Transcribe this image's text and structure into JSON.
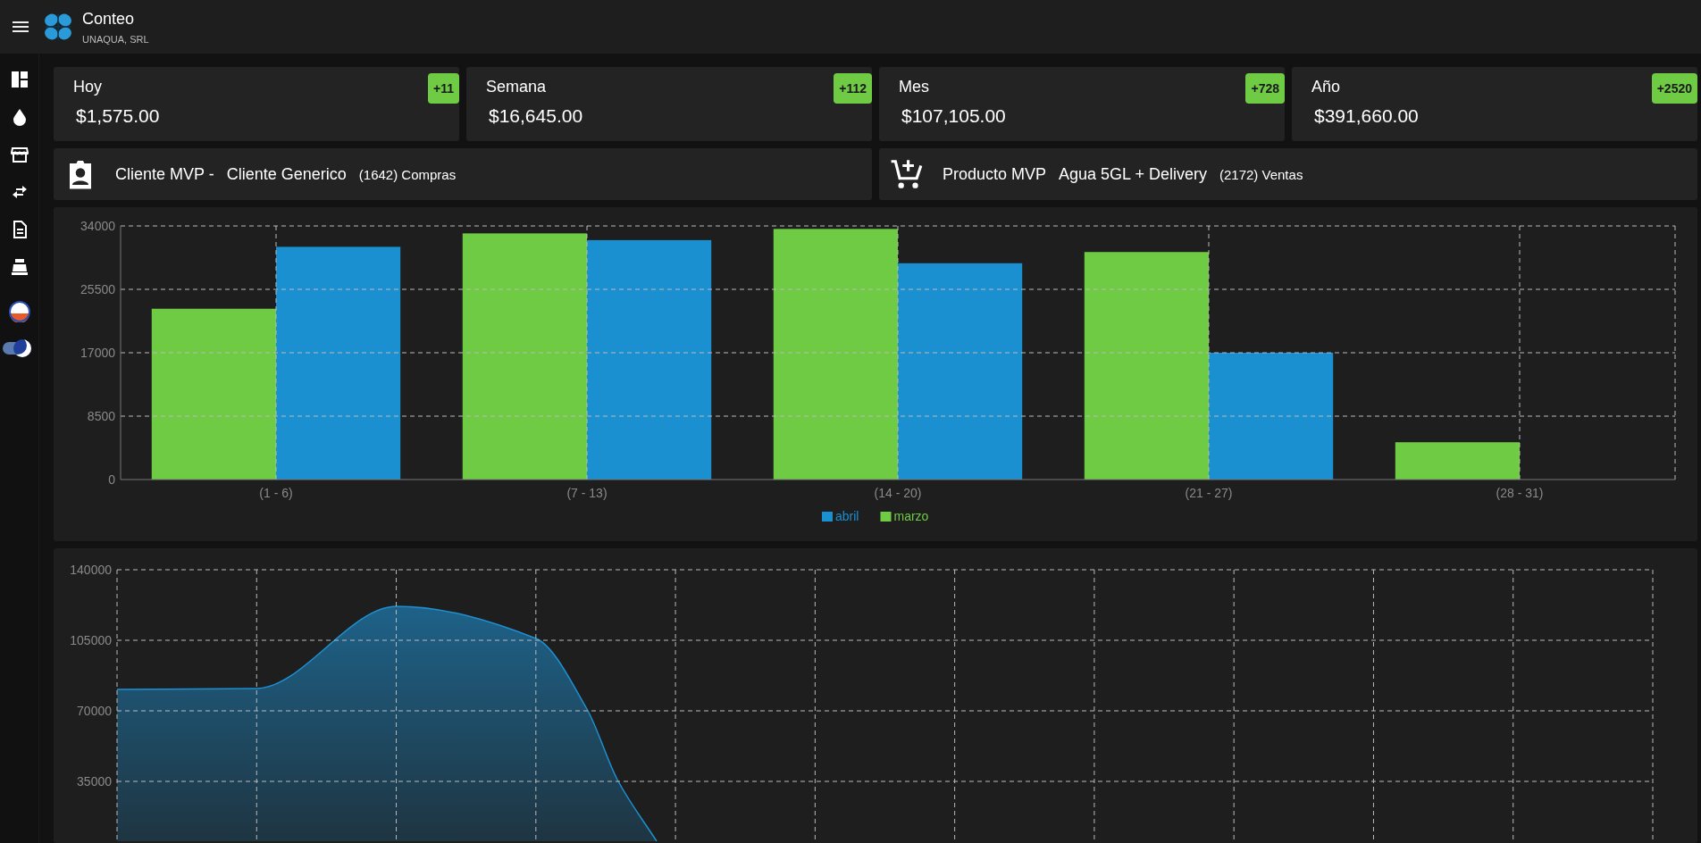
{
  "header": {
    "title": "Conteo",
    "subtitle": "UNAQUA, SRL"
  },
  "sidebar": {
    "dark_mode": {
      "on": true
    }
  },
  "stats": [
    {
      "label": "Hoy",
      "value": "$1,575.00",
      "badge": "+11"
    },
    {
      "label": "Semana",
      "value": "$16,645.00",
      "badge": "+112"
    },
    {
      "label": "Mes",
      "value": "$107,105.00",
      "badge": "+728"
    },
    {
      "label": "Año",
      "value": "$391,660.00",
      "badge": "+2520"
    }
  ],
  "mvp": [
    {
      "kind": "client",
      "label": "Cliente MVP -",
      "name": "Cliente Generico",
      "count": "(1642) Compras"
    },
    {
      "kind": "product",
      "label": "Producto MVP",
      "name": "Agua 5GL + Delivery",
      "count": "(2172) Ventas"
    }
  ],
  "weekly_chart": {
    "chart_data": {
      "type": "bar",
      "grid": true,
      "legend": "bottom",
      "categories": [
        "(1 - 6)",
        "(7 - 13)",
        "(14 - 20)",
        "(21 - 27)",
        "(28 - 31)"
      ],
      "ylim": [
        0,
        34000
      ],
      "yticks": [
        0,
        8500,
        17000,
        25500,
        34000
      ],
      "series": [
        {
          "name": "abril",
          "color": "#1a90d0",
          "values": [
            31200,
            32100,
            29000,
            17000,
            null
          ]
        },
        {
          "name": "marzo",
          "color": "#6fcb43",
          "values": [
            22900,
            33000,
            33600,
            30500,
            5000
          ]
        }
      ]
    }
  },
  "trend_chart": {
    "y_labels": [
      "140000",
      "105000",
      "70000",
      "35000"
    ]
  }
}
